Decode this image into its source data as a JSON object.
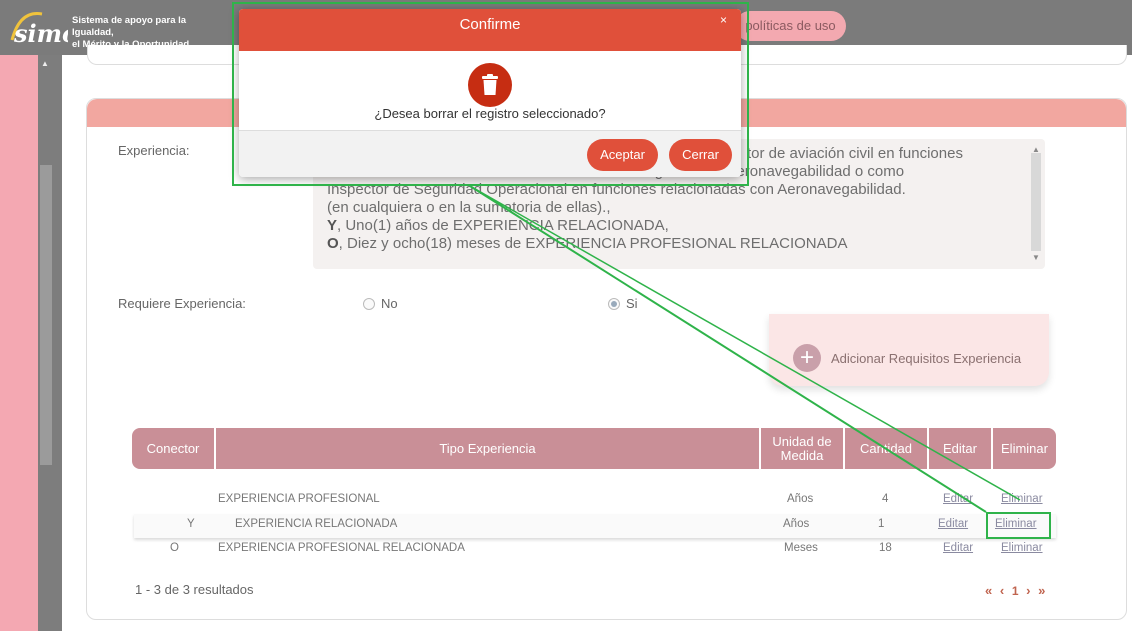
{
  "header": {
    "logo_text_line1": "Sistema de apoyo para la Igualdad,",
    "logo_text_line2": "el Mérito y la Oportunidad",
    "logo_word": "simo",
    "policies_label": "políticas de uso"
  },
  "form": {
    "experience_label": "Experiencia:",
    "experience_text_line1": "tor de aviación civil en funciones",
    "experience_text_line2": "relacionadas con mantenimiento de aeronaves o gestión de aeronavegabilidad o como",
    "experience_text_line3": "Inspector de Seguridad Operacional en funciones relacionadas con Aeronavegabilidad.",
    "experience_text_line4": "(en cualquiera o en la sumatoria de ellas).,",
    "experience_text_line5_prefix": "Y",
    "experience_text_line5": ", Uno(1) años de EXPERIENCIA RELACIONADA,",
    "experience_text_line6_prefix": "O",
    "experience_text_line6": ", Diez y ocho(18) meses de EXPERIENCIA PROFESIONAL RELACIONADA",
    "requires_experience_label": "Requiere Experiencia:",
    "option_no": "No",
    "option_si": "Si",
    "add_requirement_label": "Adicionar Requisitos Experiencia"
  },
  "table": {
    "headers": {
      "connector": "Conector",
      "type": "Tipo Experiencia",
      "unit_line1": "Unidad de",
      "unit_line2": "Medida",
      "quantity": "Cantidad",
      "edit": "Editar",
      "delete": "Eliminar"
    },
    "rows": [
      {
        "connector": "",
        "type": "EXPERIENCIA PROFESIONAL",
        "unit": "Años",
        "quantity": "4",
        "edit": "Editar",
        "delete": "Eliminar"
      },
      {
        "connector": "Y",
        "type": "EXPERIENCIA RELACIONADA",
        "unit": "Años",
        "quantity": "1",
        "edit": "Editar",
        "delete": "Eliminar"
      },
      {
        "connector": "O",
        "type": "EXPERIENCIA PROFESIONAL RELACIONADA",
        "unit": "Meses",
        "quantity": "18",
        "edit": "Editar",
        "delete": "Eliminar"
      }
    ],
    "results_text": "1 - 3 de 3 resultados",
    "pager": {
      "first": "«",
      "prev": "‹",
      "page": "1",
      "next": "›",
      "last": "»"
    }
  },
  "modal": {
    "title": "Confirme",
    "close": "×",
    "message": "¿Desea borrar el registro seleccionado?",
    "accept_label": "Aceptar",
    "close_label": "Cerrar",
    "icon": "trash-icon"
  },
  "colors": {
    "modal_header": "#e0503a",
    "annotation": "#2fb34a",
    "table_header": "#c98f97",
    "sidebar_pink": "#f4a8b2"
  }
}
